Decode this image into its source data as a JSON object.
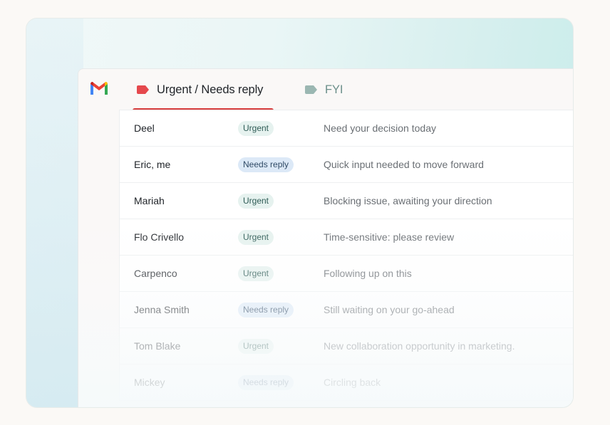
{
  "tabs": [
    {
      "label": "Urgent / Needs reply",
      "active": true,
      "icon": "label-tag-icon",
      "color": "#e5484d"
    },
    {
      "label": "FYI",
      "active": false,
      "icon": "label-tag-icon",
      "color": "#9bb7b2"
    }
  ],
  "emails": [
    {
      "sender": "Deel",
      "badge": "Urgent",
      "subject": "Need your decision today"
    },
    {
      "sender": "Eric, me",
      "badge": "Needs reply",
      "subject": "Quick input needed to move forward"
    },
    {
      "sender": "Mariah",
      "badge": "Urgent",
      "subject": "Blocking issue, awaiting your direction"
    },
    {
      "sender": "Flo Crivello",
      "badge": "Urgent",
      "subject": "Time-sensitive: please review"
    },
    {
      "sender": "Carpenco",
      "badge": "Urgent",
      "subject": "Following up on this"
    },
    {
      "sender": "Jenna Smith",
      "badge": "Needs reply",
      "subject": "Still waiting on your go-ahead"
    },
    {
      "sender": "Tom Blake",
      "badge": "Urgent",
      "subject": "New collaboration opportunity in marketing."
    },
    {
      "sender": "Mickey",
      "badge": "Needs reply",
      "subject": "Circling back"
    }
  ],
  "colors": {
    "accent": "#d63b3b",
    "urgent_badge": "#e6f2ef",
    "reply_badge": "#dce9f7"
  }
}
